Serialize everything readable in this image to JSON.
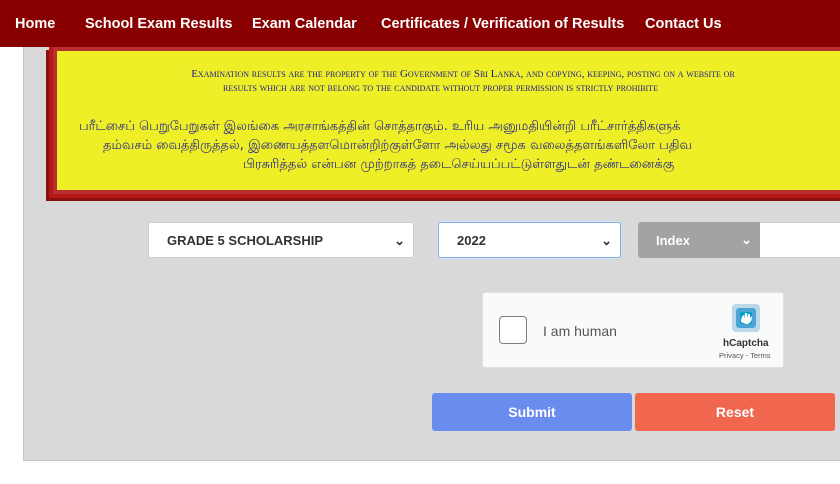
{
  "nav": {
    "items": [
      "Home",
      "School Exam Results",
      "Exam Calendar",
      "Certificates / Verification of Results",
      "Contact Us"
    ]
  },
  "notice": {
    "english_line1": "Examination results are the property of the Government of Sri Lanka, and copying, keeping, posting on a website or",
    "english_line2": "results which are not belong to the candidate without proper permission is strictly prohibite",
    "tamil_line1": "பரீட்சைப் பெறுபேறுகள் இலங்கை அரசாங்கத்தின் சொத்தாகும். உரிய அனுமதியின்றி பரீட்சார்த்திகளுக்",
    "tamil_line2": "தம்வசம் வைத்திருத்தல், இணையத்தளமொன்றிற்குள்ளோ அல்லது சமூக வலைத்தளங்களிலோ பதிவ",
    "tamil_line3": "பிரசுரித்தல் என்பன முற்றாகத் தடைசெய்யப்பட்டுள்ளதுடன் தண்டனைக்கு"
  },
  "form": {
    "exam_select": "GRADE 5 SCHOLARSHIP",
    "year_select": "2022",
    "index_select": "Index",
    "index_input_value": ""
  },
  "captcha": {
    "label": "I am human",
    "brand": "hCaptcha",
    "links": "Privacy - Terms"
  },
  "buttons": {
    "submit": "Submit",
    "reset": "Reset"
  },
  "colors": {
    "nav_bg": "#880000",
    "notice_bg": "#efef28",
    "notice_border": "#b81818",
    "submit_bg": "#6b8cef",
    "reset_bg": "#f0664f",
    "index_bg": "#a3a3a3"
  }
}
